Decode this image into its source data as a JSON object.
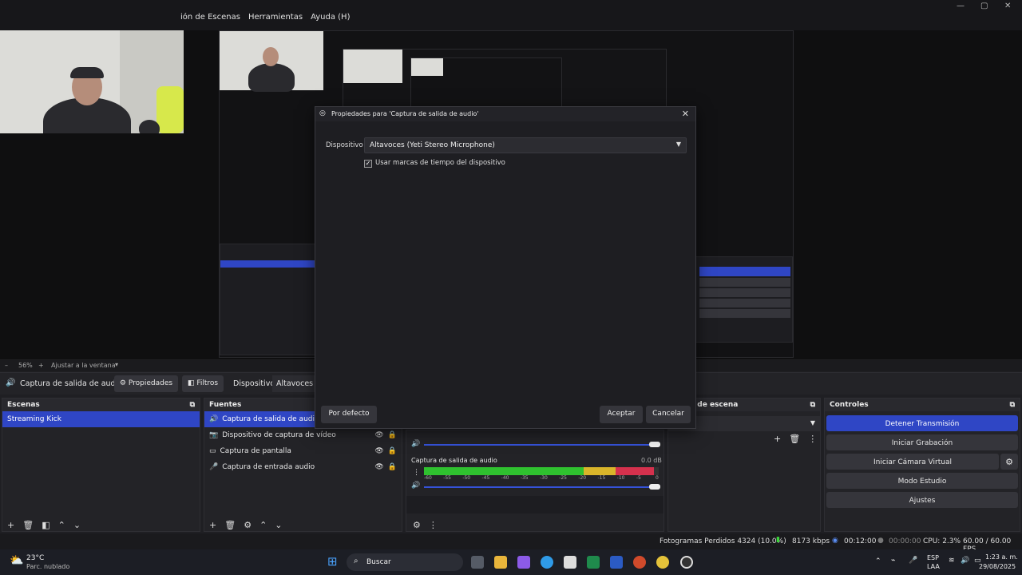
{
  "menu": [
    "ión de Escenas",
    "Herramientas",
    "Ayuda (H)"
  ],
  "window_controls": [
    "—",
    "▢",
    "✕"
  ],
  "zoom": {
    "minus": "–",
    "percent": "56%",
    "plus": "+",
    "fit": "Ajustar a la ventana"
  },
  "source_toolbar": {
    "source_name": "Captura de salida de audio",
    "properties": "Propiedades",
    "filters": "Filtros",
    "device_label": "Dispositivo",
    "device_value": "Altavoces (Ye"
  },
  "scenes": {
    "title": "Escenas",
    "items": [
      "Streaming Kick"
    ]
  },
  "sources": {
    "title": "Fuentes",
    "items": [
      {
        "label": "Captura de salida de audio"
      },
      {
        "label": "Dispositivo de captura de vídeo"
      },
      {
        "label": "Captura de pantalla"
      },
      {
        "label": "Captura de entrada audio"
      }
    ]
  },
  "mixer": {
    "ticks": [
      "-60",
      "-55",
      "-50",
      "-45",
      "-40",
      "-35",
      "-30",
      "-25",
      "-20",
      "-15",
      "-10",
      "-5",
      "0"
    ],
    "channels": [
      {
        "name": "Captura de salida de audio",
        "db": "0.0 dB",
        "level": 0.98
      }
    ]
  },
  "transitions": {
    "title": "iones de escena"
  },
  "controls": {
    "title": "Controles",
    "stop_stream": "Detener Transmisión",
    "start_record": "Iniciar Grabación",
    "start_vcam": "Iniciar Cámara Virtual",
    "studio_mode": "Modo Estudio",
    "settings": "Ajustes"
  },
  "status": {
    "dropped": "Fotogramas Perdidos 4324 (10.0%)",
    "bitrate": "8173 kbps",
    "stream_time": "00:12:00",
    "record_time": "00:00:00",
    "cpu": "CPU: 2.3%",
    "fps": "60.00 / 60.00 FPS"
  },
  "dialog": {
    "title": "Propiedades para 'Captura de salida de audio'",
    "device_label": "Dispositivo",
    "device_value": "Altavoces (Yeti Stereo Microphone)",
    "timestamps_label": "Usar marcas de tiempo del dispositivo",
    "timestamps_checked": true,
    "defaults": "Por defecto",
    "ok": "Aceptar",
    "cancel": "Cancelar"
  },
  "taskbar": {
    "weather_temp": "23°C",
    "weather_desc": "Parc. nublado",
    "search": "Buscar",
    "lang_top": "ESP",
    "lang_bottom": "LAA",
    "time": "1:23 a. m.",
    "date": "29/08/2025"
  },
  "colors": {
    "accent": "#2f46c5",
    "meter_green": "#2fc12f",
    "meter_yellow": "#d9b52a",
    "meter_red": "#d5314d"
  }
}
